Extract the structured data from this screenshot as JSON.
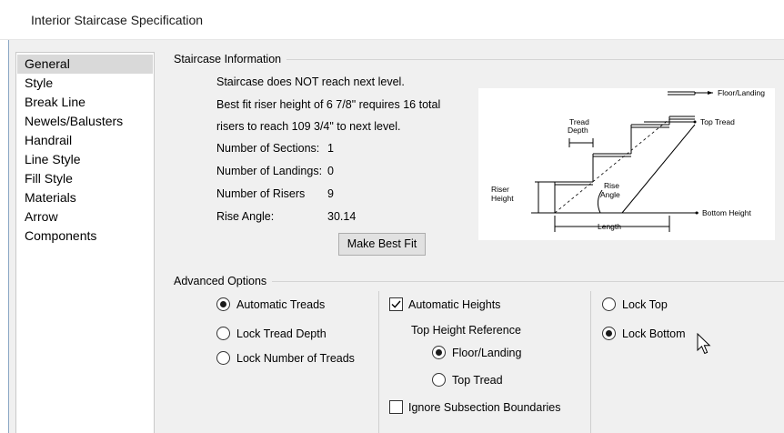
{
  "window": {
    "title": "Interior Staircase Specification"
  },
  "nav": {
    "items": [
      {
        "label": "General",
        "selected": true
      },
      {
        "label": "Style"
      },
      {
        "label": "Break Line"
      },
      {
        "label": "Newels/Balusters"
      },
      {
        "label": "Handrail"
      },
      {
        "label": "Line Style"
      },
      {
        "label": "Fill Style"
      },
      {
        "label": "Materials"
      },
      {
        "label": "Arrow"
      },
      {
        "label": "Components"
      }
    ]
  },
  "staircase_info": {
    "group_title": "Staircase Information",
    "line1": "Staircase does NOT reach next level.",
    "line2": "Best fit riser height of 6 7/8\" requires 16 total",
    "line3": "risers to reach 109 3/4\" to next level.",
    "sections_label": "Number of Sections:",
    "sections_value": "1",
    "landings_label": "Number of Landings:",
    "landings_value": "0",
    "risers_label": "Number of Risers",
    "risers_value": "9",
    "rise_angle_label": "Rise Angle:",
    "rise_angle_value": "30.14",
    "best_fit_button": "Make Best Fit"
  },
  "diagram": {
    "floor_landing": "Floor/Landing",
    "top_tread": "Top Tread",
    "tread": "Tread",
    "depth": "Depth",
    "riser": "Riser",
    "height": "Height",
    "rise": "Rise",
    "angle": "Angle",
    "bottom_height": "Bottom Height",
    "length": "Length"
  },
  "advanced": {
    "group_title": "Advanced Options",
    "treads": [
      {
        "label": "Automatic Treads",
        "checked": true
      },
      {
        "label": "Lock Tread Depth",
        "checked": false
      },
      {
        "label": "Lock Number of Treads",
        "checked": false
      }
    ],
    "automatic_heights": {
      "label": "Automatic Heights",
      "checked": true
    },
    "top_height_reference": "Top Height Reference",
    "reference_options": [
      {
        "label": "Floor/Landing",
        "checked": true
      },
      {
        "label": "Top Tread",
        "checked": false
      }
    ],
    "ignore_subsection": {
      "label": "Ignore Subsection Boundaries",
      "checked": false
    },
    "lock_options": [
      {
        "label": "Lock Top",
        "checked": false
      },
      {
        "label": "Lock Bottom",
        "checked": true
      }
    ]
  }
}
